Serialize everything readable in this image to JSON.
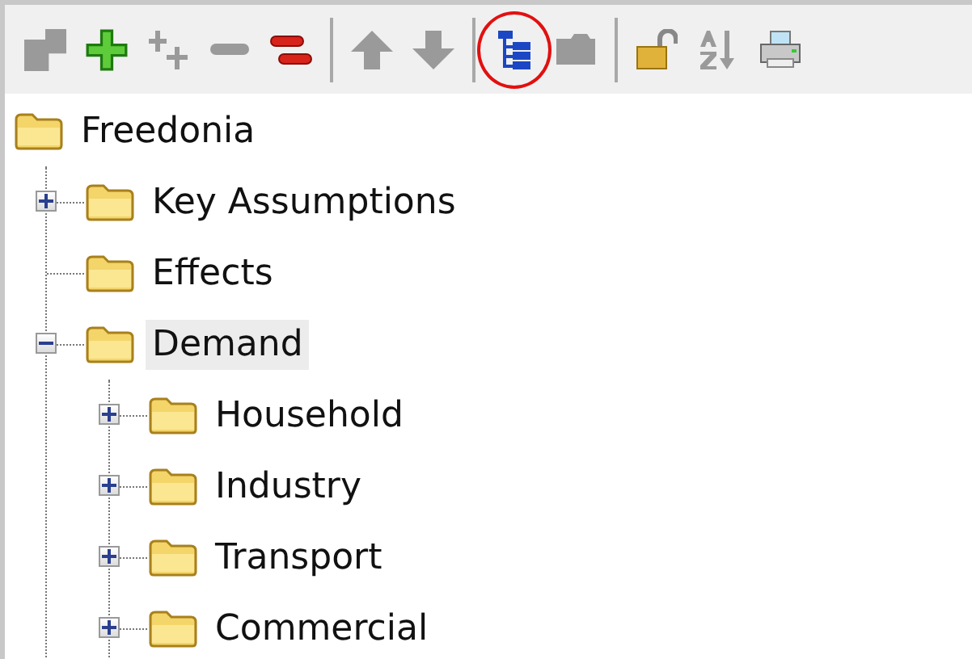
{
  "toolbar": {
    "buttons": [
      {
        "kind": "add-sibling",
        "disabled": true
      },
      {
        "kind": "add",
        "disabled": false
      },
      {
        "kind": "add-many",
        "disabled": true
      },
      {
        "kind": "remove",
        "disabled": true
      },
      {
        "kind": "remove-many",
        "disabled": false
      },
      {
        "kind": "separator"
      },
      {
        "kind": "up",
        "disabled": true
      },
      {
        "kind": "down",
        "disabled": true
      },
      {
        "kind": "separator"
      },
      {
        "kind": "tree",
        "disabled": false,
        "highlighted": true
      },
      {
        "kind": "folder",
        "disabled": true
      },
      {
        "kind": "separator"
      },
      {
        "kind": "lock",
        "disabled": false
      },
      {
        "kind": "sort",
        "disabled": true
      },
      {
        "kind": "print",
        "disabled": false
      }
    ]
  },
  "tree": {
    "label": "Freedonia",
    "selected": false,
    "children": [
      {
        "label": "Key Assumptions",
        "selected": false,
        "expanded": false
      },
      {
        "label": "Effects",
        "selected": false
      },
      {
        "label": "Demand",
        "selected": true,
        "expanded": true,
        "children": [
          {
            "label": "Household",
            "selected": false,
            "expanded": false
          },
          {
            "label": "Industry",
            "selected": false,
            "expanded": false
          },
          {
            "label": "Transport",
            "selected": false,
            "expanded": false
          },
          {
            "label": "Commercial",
            "selected": false,
            "expanded": false
          }
        ]
      }
    ]
  }
}
